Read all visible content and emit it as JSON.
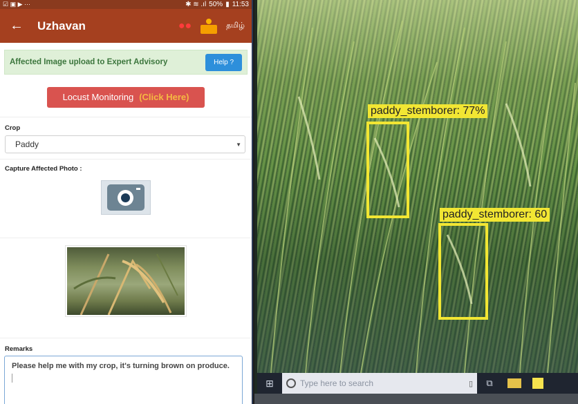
{
  "phone": {
    "statusbar": {
      "left_icons": "☑ ▣ ▶ ···",
      "signal": "✱ ≋ .ıl",
      "battery": "50%",
      "time": "11:53"
    },
    "appbar": {
      "back_icon": "←",
      "title": "Uzhavan",
      "language": "தமிழ்"
    },
    "advisory": {
      "text": "Affected Image upload to Expert Advisory",
      "help_label": "Help ?"
    },
    "locust": {
      "label": "Locust Monitoring",
      "highlight": "(Click Here)"
    },
    "crop": {
      "label": "Crop",
      "selected": "Paddy"
    },
    "capture": {
      "label": "Capture Affected Photo :"
    },
    "remarks": {
      "label": "Remarks",
      "value": "Please help me with my crop, it's turning brown on produce."
    }
  },
  "monitor": {
    "detections": [
      {
        "label": "paddy_stemborer: 77%"
      },
      {
        "label": "paddy_stemborer: 60"
      }
    ],
    "taskbar": {
      "search_placeholder": "Type here to search"
    }
  },
  "colors": {
    "appbar": "#a5401f",
    "detection": "#f2e633",
    "locust_button": "#d9534f",
    "help_button": "#2d8fdb"
  }
}
